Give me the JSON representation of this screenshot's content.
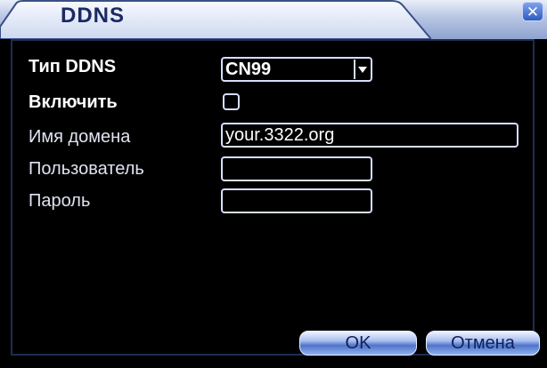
{
  "window": {
    "title": "DDNS",
    "close_glyph": "✕"
  },
  "form": {
    "ddns_type": {
      "label": "Тип DDNS",
      "value": "CN99"
    },
    "enable": {
      "label": "Включить",
      "checked": false
    },
    "domain_name": {
      "label": "Имя домена",
      "value": "your.3322.org"
    },
    "user": {
      "label": "Пользователь",
      "value": ""
    },
    "password": {
      "label": "Пароль",
      "value": ""
    }
  },
  "buttons": {
    "ok": "OK",
    "cancel": "Отмена"
  },
  "colors": {
    "background": "#000000",
    "text": "#ffffff",
    "field_border": "#d7defa",
    "title_text": "#1a2a63",
    "button_text": "#10205a"
  },
  "icons": {
    "close": "close-icon",
    "dropdown": "chevron-down-icon"
  }
}
